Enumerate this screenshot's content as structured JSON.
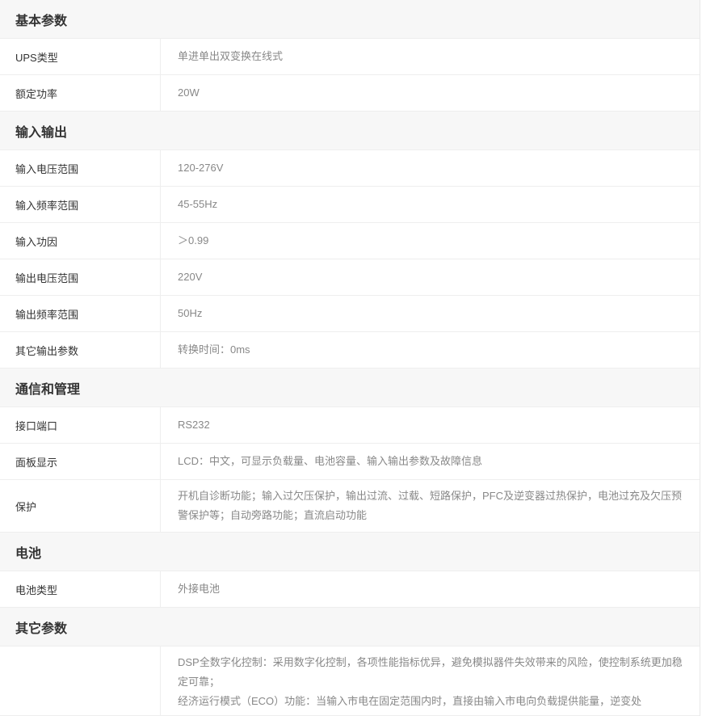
{
  "sections": [
    {
      "title": "基本参数",
      "rows": [
        {
          "label": "UPS类型",
          "value": "单进单出双变换在线式"
        },
        {
          "label": "额定功率",
          "value": "20W"
        }
      ]
    },
    {
      "title": "输入输出",
      "rows": [
        {
          "label": "输入电压范围",
          "value": "120-276V"
        },
        {
          "label": "输入频率范围",
          "value": "45-55Hz"
        },
        {
          "label": "输入功因",
          "value": "＞0.99"
        },
        {
          "label": "输出电压范围",
          "value": "220V"
        },
        {
          "label": "输出频率范围",
          "value": "50Hz"
        },
        {
          "label": "其它输出参数",
          "value": "转换时间：0ms"
        }
      ]
    },
    {
      "title": "通信和管理",
      "rows": [
        {
          "label": "接口端口",
          "value": "RS232"
        },
        {
          "label": "面板显示",
          "value": "LCD：中文，可显示负载量、电池容量、输入输出参数及故障信息"
        },
        {
          "label": "保护",
          "value": "开机自诊断功能；输入过欠压保护，输出过流、过载、短路保护，PFC及逆变器过热保护，电池过充及欠压预警保护等；自动旁路功能；直流启动功能"
        }
      ]
    },
    {
      "title": "电池",
      "rows": [
        {
          "label": "电池类型",
          "value": "外接电池"
        }
      ]
    },
    {
      "title": "其它参数",
      "rows": [
        {
          "label": "",
          "lines": [
            "DSP全数字化控制：采用数字化控制，各项性能指标优异，避免模拟器件失效带来的风险，使控制系统更加稳定可靠；",
            "经济运行模式（ECO）功能：当输入市电在固定范围内时，直接由输入市电向负载提供能量，逆变处"
          ]
        }
      ]
    }
  ]
}
